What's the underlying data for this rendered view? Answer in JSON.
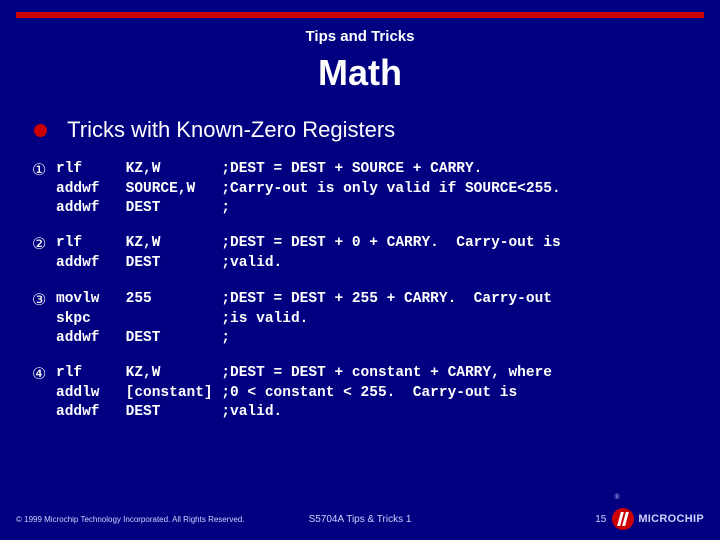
{
  "header": {
    "small": "Tips and Tricks",
    "big": "Math"
  },
  "lead": "Tricks with Known-Zero Registers",
  "markers": {
    "m1": "①",
    "m2": "②",
    "m3": "③",
    "m4": "④"
  },
  "blocks": {
    "b1": "rlf     KZ,W       ;DEST = DEST + SOURCE + CARRY.\naddwf   SOURCE,W   ;Carry-out is only valid if SOURCE<255.\naddwf   DEST       ;",
    "b2": "rlf     KZ,W       ;DEST = DEST + 0 + CARRY.  Carry-out is\naddwf   DEST       ;valid.",
    "b3": "movlw   255        ;DEST = DEST + 255 + CARRY.  Carry-out\nskpc               ;is valid.\naddwf   DEST       ;",
    "b4": "rlf     KZ,W       ;DEST = DEST + constant + CARRY, where\naddlw   [constant] ;0 < constant < 255.  Carry-out is\naddwf   DEST       ;valid."
  },
  "footer": {
    "left": "© 1999 Microchip Technology Incorporated. All Rights Reserved.",
    "center": "S5704A Tips & Tricks 1",
    "page": "15",
    "brand": "MICROCHIP",
    "reg": "®"
  }
}
